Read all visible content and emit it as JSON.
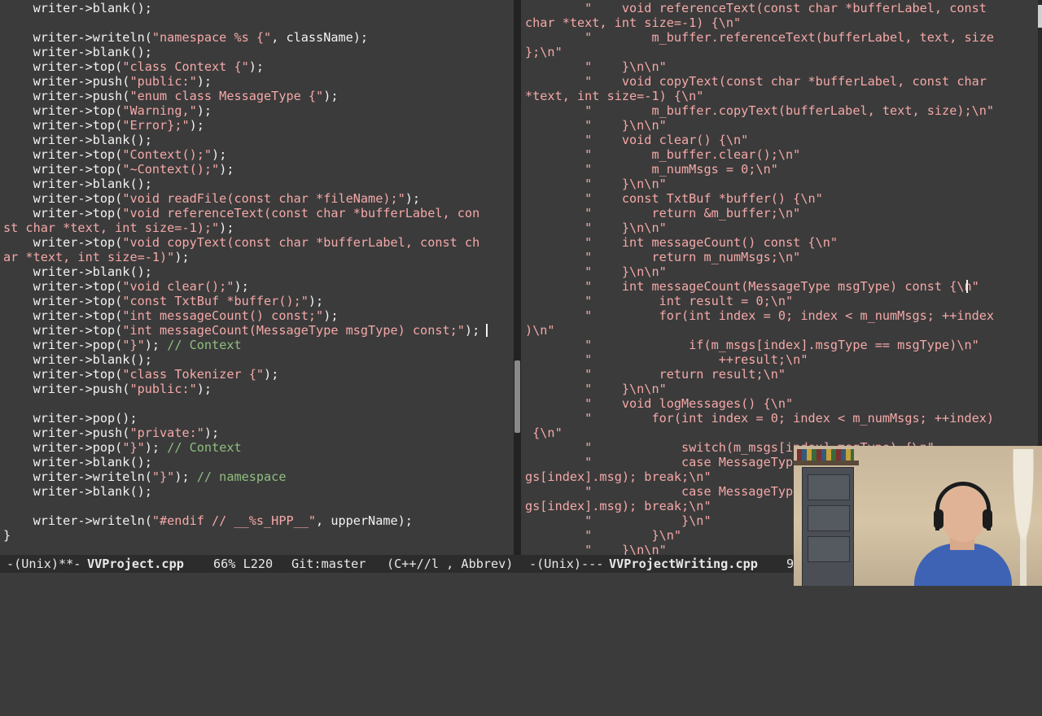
{
  "colors": {
    "background": "#3b3b3b",
    "text": "#f2f2f2",
    "string": "#f5a8a8",
    "comment": "#8fbf7f",
    "modeline_bg": "#2c2c2c"
  },
  "left_pane": {
    "lines": [
      [
        [
          "p",
          "    writer->blank();"
        ]
      ],
      [
        [
          "p",
          ""
        ]
      ],
      [
        [
          "p",
          "    writer->writeln("
        ],
        [
          "s",
          "\"namespace %s {\""
        ],
        [
          "p",
          ", className);"
        ]
      ],
      [
        [
          "p",
          "    writer->blank();"
        ]
      ],
      [
        [
          "p",
          "    writer->top("
        ],
        [
          "s",
          "\"class Context {\""
        ],
        [
          "p",
          ");"
        ]
      ],
      [
        [
          "p",
          "    writer->push("
        ],
        [
          "s",
          "\"public:\""
        ],
        [
          "p",
          ");"
        ]
      ],
      [
        [
          "p",
          "    writer->push("
        ],
        [
          "s",
          "\"enum class MessageType {\""
        ],
        [
          "p",
          ");"
        ]
      ],
      [
        [
          "p",
          "    writer->top("
        ],
        [
          "s",
          "\"Warning,\""
        ],
        [
          "p",
          ");"
        ]
      ],
      [
        [
          "p",
          "    writer->top("
        ],
        [
          "s",
          "\"Error};\""
        ],
        [
          "p",
          ");"
        ]
      ],
      [
        [
          "p",
          "    writer->blank();"
        ]
      ],
      [
        [
          "p",
          "    writer->top("
        ],
        [
          "s",
          "\"Context();\""
        ],
        [
          "p",
          ");"
        ]
      ],
      [
        [
          "p",
          "    writer->top("
        ],
        [
          "s",
          "\"~Context();\""
        ],
        [
          "p",
          ");"
        ]
      ],
      [
        [
          "p",
          "    writer->blank();"
        ]
      ],
      [
        [
          "p",
          "    writer->top("
        ],
        [
          "s",
          "\"void readFile(const char *fileName);\""
        ],
        [
          "p",
          ");"
        ]
      ],
      [
        [
          "p",
          "    writer->top("
        ],
        [
          "s",
          "\"void referenceText(const char *bufferLabel, con"
        ]
      ],
      [
        [
          "s",
          "st char *text, int size=-1);\""
        ],
        [
          "p",
          ");"
        ]
      ],
      [
        [
          "p",
          "    writer->top("
        ],
        [
          "s",
          "\"void copyText(const char *bufferLabel, const ch"
        ]
      ],
      [
        [
          "s",
          "ar *text, int size=-1)\""
        ],
        [
          "p",
          ");"
        ]
      ],
      [
        [
          "p",
          "    writer->blank();"
        ]
      ],
      [
        [
          "p",
          "    writer->top("
        ],
        [
          "s",
          "\"void clear();\""
        ],
        [
          "p",
          ");"
        ]
      ],
      [
        [
          "p",
          "    writer->top("
        ],
        [
          "s",
          "\"const TxtBuf *buffer();\""
        ],
        [
          "p",
          ");"
        ]
      ],
      [
        [
          "p",
          "    writer->top("
        ],
        [
          "s",
          "\"int messageCount() const;\""
        ],
        [
          "p",
          ");"
        ]
      ],
      [
        [
          "p",
          "    writer->top("
        ],
        [
          "s",
          "\"int messageCount(MessageType msgType) const;\""
        ],
        [
          "p",
          ");"
        ]
      ],
      [
        [
          "p",
          "    writer->pop("
        ],
        [
          "s",
          "\"}\""
        ],
        [
          "p",
          "); "
        ],
        [
          "c",
          "// Context"
        ]
      ],
      [
        [
          "p",
          "    writer->blank();"
        ]
      ],
      [
        [
          "p",
          "    writer->top("
        ],
        [
          "s",
          "\"class Tokenizer {\""
        ],
        [
          "p",
          ");"
        ]
      ],
      [
        [
          "p",
          "    writer->push("
        ],
        [
          "s",
          "\"public:\""
        ],
        [
          "p",
          ");"
        ]
      ],
      [
        [
          "p",
          ""
        ]
      ],
      [
        [
          "p",
          "    writer->pop();"
        ]
      ],
      [
        [
          "p",
          "    writer->push("
        ],
        [
          "s",
          "\"private:\""
        ],
        [
          "p",
          ");"
        ]
      ],
      [
        [
          "p",
          "    writer->pop("
        ],
        [
          "s",
          "\"}\""
        ],
        [
          "p",
          "); "
        ],
        [
          "c",
          "// Context"
        ]
      ],
      [
        [
          "p",
          "    writer->blank();"
        ]
      ],
      [
        [
          "p",
          "    writer->writeln("
        ],
        [
          "s",
          "\"}\""
        ],
        [
          "p",
          "); "
        ],
        [
          "c",
          "// namespace"
        ]
      ],
      [
        [
          "p",
          "    writer->blank();"
        ]
      ],
      [
        [
          "p",
          ""
        ]
      ],
      [
        [
          "p",
          "    writer->writeln("
        ],
        [
          "s",
          "\"#endif // __%s_HPP__\""
        ],
        [
          "p",
          ", upperName);"
        ]
      ],
      [
        [
          "p",
          "}"
        ]
      ]
    ]
  },
  "right_pane": {
    "lines": [
      [
        [
          "s",
          "        \"    void referenceText(const char *bufferLabel, const"
        ]
      ],
      [
        [
          "s",
          "char *text, int size=-1) {\\n\""
        ]
      ],
      [
        [
          "s",
          "        \"        m_buffer.referenceText(bufferLabel, text, size"
        ]
      ],
      [
        [
          "s",
          "};\\n\""
        ]
      ],
      [
        [
          "s",
          "        \"    }\\n\\n\""
        ]
      ],
      [
        [
          "s",
          "        \"    void copyText(const char *bufferLabel, const char"
        ]
      ],
      [
        [
          "s",
          "*text, int size=-1) {\\n\""
        ]
      ],
      [
        [
          "s",
          "        \"        m_buffer.copyText(bufferLabel, text, size);\\n\""
        ]
      ],
      [
        [
          "s",
          "        \"    }\\n\\n\""
        ]
      ],
      [
        [
          "s",
          "        \"    void clear() {\\n\""
        ]
      ],
      [
        [
          "s",
          "        \"        m_buffer.clear();\\n\""
        ]
      ],
      [
        [
          "s",
          "        \"        m_numMsgs = 0;\\n\""
        ]
      ],
      [
        [
          "s",
          "        \"    }\\n\\n\""
        ]
      ],
      [
        [
          "s",
          "        \"    const TxtBuf *buffer() {\\n\""
        ]
      ],
      [
        [
          "s",
          "        \"        return &m_buffer;\\n\""
        ]
      ],
      [
        [
          "s",
          "        \"    }\\n\\n\""
        ]
      ],
      [
        [
          "s",
          "        \"    int messageCount() const {\\n\""
        ]
      ],
      [
        [
          "s",
          "        \"        return m_numMsgs;\\n\""
        ]
      ],
      [
        [
          "s",
          "        \"    }\\n\\n\""
        ]
      ],
      [
        [
          "s",
          "        \"    int messageCount(MessageType msgType) const {\\n\""
        ]
      ],
      [
        [
          "s",
          "        \"         int result = 0;\\n\""
        ]
      ],
      [
        [
          "s",
          "        \"         for(int index = 0; index < m_numMsgs; ++index"
        ]
      ],
      [
        [
          "s",
          ")\\n\""
        ]
      ],
      [
        [
          "s",
          "        \"             if(m_msgs[index].msgType == msgType)\\n\""
        ]
      ],
      [
        [
          "s",
          "        \"                 ++result;\\n\""
        ]
      ],
      [
        [
          "s",
          "        \"         return result;\\n\""
        ]
      ],
      [
        [
          "s",
          "        \"    }\\n\\n\""
        ]
      ],
      [
        [
          "s",
          "        \"    void logMessages() {\\n\""
        ]
      ],
      [
        [
          "s",
          "        \"        for(int index = 0; index < m_numMsgs; ++index)"
        ]
      ],
      [
        [
          "s",
          " {\\n\""
        ]
      ],
      [
        [
          "s",
          "        \"            switch(m_msgs[index].msgType) {\\n\""
        ]
      ],
      [
        [
          "s",
          "        \"            case MessageType"
        ]
      ],
      [
        [
          "s",
          "gs[index].msg); break;\\n\""
        ]
      ],
      [
        [
          "s",
          "        \"            case MessageType"
        ]
      ],
      [
        [
          "s",
          "gs[index].msg); break;\\n\""
        ]
      ],
      [
        [
          "s",
          "        \"            }\\n\""
        ]
      ],
      [
        [
          "s",
          "        \"        }\\n\""
        ]
      ],
      [
        [
          "s",
          "        \"    }\\n\\n\""
        ]
      ]
    ]
  },
  "modeline": {
    "left_status": "-(Unix)**-",
    "left_buffer": "VVProject.cpp",
    "left_position": "66% L220",
    "left_vcs": "Git:master",
    "left_modes": "(C++//l , Abbrev)",
    "right_status": "-(Unix)---",
    "right_buffer": "VVProjectWriting.cpp",
    "right_trunc": "9"
  },
  "scrollbar": {
    "left_fraction_top": 0.65,
    "left_fraction_size": 0.13
  }
}
